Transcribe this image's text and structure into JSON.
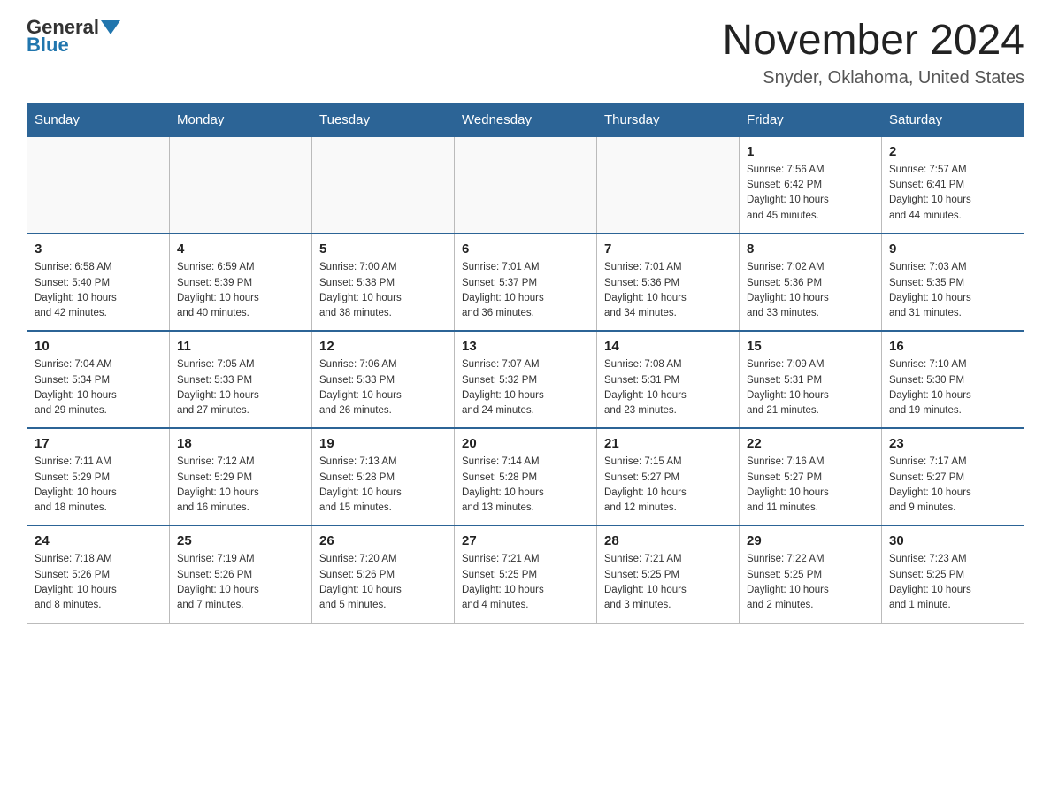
{
  "logo": {
    "general": "General",
    "blue": "Blue"
  },
  "title": "November 2024",
  "location": "Snyder, Oklahoma, United States",
  "days_header": [
    "Sunday",
    "Monday",
    "Tuesday",
    "Wednesday",
    "Thursday",
    "Friday",
    "Saturday"
  ],
  "weeks": [
    [
      {
        "day": "",
        "info": ""
      },
      {
        "day": "",
        "info": ""
      },
      {
        "day": "",
        "info": ""
      },
      {
        "day": "",
        "info": ""
      },
      {
        "day": "",
        "info": ""
      },
      {
        "day": "1",
        "info": "Sunrise: 7:56 AM\nSunset: 6:42 PM\nDaylight: 10 hours\nand 45 minutes."
      },
      {
        "day": "2",
        "info": "Sunrise: 7:57 AM\nSunset: 6:41 PM\nDaylight: 10 hours\nand 44 minutes."
      }
    ],
    [
      {
        "day": "3",
        "info": "Sunrise: 6:58 AM\nSunset: 5:40 PM\nDaylight: 10 hours\nand 42 minutes."
      },
      {
        "day": "4",
        "info": "Sunrise: 6:59 AM\nSunset: 5:39 PM\nDaylight: 10 hours\nand 40 minutes."
      },
      {
        "day": "5",
        "info": "Sunrise: 7:00 AM\nSunset: 5:38 PM\nDaylight: 10 hours\nand 38 minutes."
      },
      {
        "day": "6",
        "info": "Sunrise: 7:01 AM\nSunset: 5:37 PM\nDaylight: 10 hours\nand 36 minutes."
      },
      {
        "day": "7",
        "info": "Sunrise: 7:01 AM\nSunset: 5:36 PM\nDaylight: 10 hours\nand 34 minutes."
      },
      {
        "day": "8",
        "info": "Sunrise: 7:02 AM\nSunset: 5:36 PM\nDaylight: 10 hours\nand 33 minutes."
      },
      {
        "day": "9",
        "info": "Sunrise: 7:03 AM\nSunset: 5:35 PM\nDaylight: 10 hours\nand 31 minutes."
      }
    ],
    [
      {
        "day": "10",
        "info": "Sunrise: 7:04 AM\nSunset: 5:34 PM\nDaylight: 10 hours\nand 29 minutes."
      },
      {
        "day": "11",
        "info": "Sunrise: 7:05 AM\nSunset: 5:33 PM\nDaylight: 10 hours\nand 27 minutes."
      },
      {
        "day": "12",
        "info": "Sunrise: 7:06 AM\nSunset: 5:33 PM\nDaylight: 10 hours\nand 26 minutes."
      },
      {
        "day": "13",
        "info": "Sunrise: 7:07 AM\nSunset: 5:32 PM\nDaylight: 10 hours\nand 24 minutes."
      },
      {
        "day": "14",
        "info": "Sunrise: 7:08 AM\nSunset: 5:31 PM\nDaylight: 10 hours\nand 23 minutes."
      },
      {
        "day": "15",
        "info": "Sunrise: 7:09 AM\nSunset: 5:31 PM\nDaylight: 10 hours\nand 21 minutes."
      },
      {
        "day": "16",
        "info": "Sunrise: 7:10 AM\nSunset: 5:30 PM\nDaylight: 10 hours\nand 19 minutes."
      }
    ],
    [
      {
        "day": "17",
        "info": "Sunrise: 7:11 AM\nSunset: 5:29 PM\nDaylight: 10 hours\nand 18 minutes."
      },
      {
        "day": "18",
        "info": "Sunrise: 7:12 AM\nSunset: 5:29 PM\nDaylight: 10 hours\nand 16 minutes."
      },
      {
        "day": "19",
        "info": "Sunrise: 7:13 AM\nSunset: 5:28 PM\nDaylight: 10 hours\nand 15 minutes."
      },
      {
        "day": "20",
        "info": "Sunrise: 7:14 AM\nSunset: 5:28 PM\nDaylight: 10 hours\nand 13 minutes."
      },
      {
        "day": "21",
        "info": "Sunrise: 7:15 AM\nSunset: 5:27 PM\nDaylight: 10 hours\nand 12 minutes."
      },
      {
        "day": "22",
        "info": "Sunrise: 7:16 AM\nSunset: 5:27 PM\nDaylight: 10 hours\nand 11 minutes."
      },
      {
        "day": "23",
        "info": "Sunrise: 7:17 AM\nSunset: 5:27 PM\nDaylight: 10 hours\nand 9 minutes."
      }
    ],
    [
      {
        "day": "24",
        "info": "Sunrise: 7:18 AM\nSunset: 5:26 PM\nDaylight: 10 hours\nand 8 minutes."
      },
      {
        "day": "25",
        "info": "Sunrise: 7:19 AM\nSunset: 5:26 PM\nDaylight: 10 hours\nand 7 minutes."
      },
      {
        "day": "26",
        "info": "Sunrise: 7:20 AM\nSunset: 5:26 PM\nDaylight: 10 hours\nand 5 minutes."
      },
      {
        "day": "27",
        "info": "Sunrise: 7:21 AM\nSunset: 5:25 PM\nDaylight: 10 hours\nand 4 minutes."
      },
      {
        "day": "28",
        "info": "Sunrise: 7:21 AM\nSunset: 5:25 PM\nDaylight: 10 hours\nand 3 minutes."
      },
      {
        "day": "29",
        "info": "Sunrise: 7:22 AM\nSunset: 5:25 PM\nDaylight: 10 hours\nand 2 minutes."
      },
      {
        "day": "30",
        "info": "Sunrise: 7:23 AM\nSunset: 5:25 PM\nDaylight: 10 hours\nand 1 minute."
      }
    ]
  ]
}
